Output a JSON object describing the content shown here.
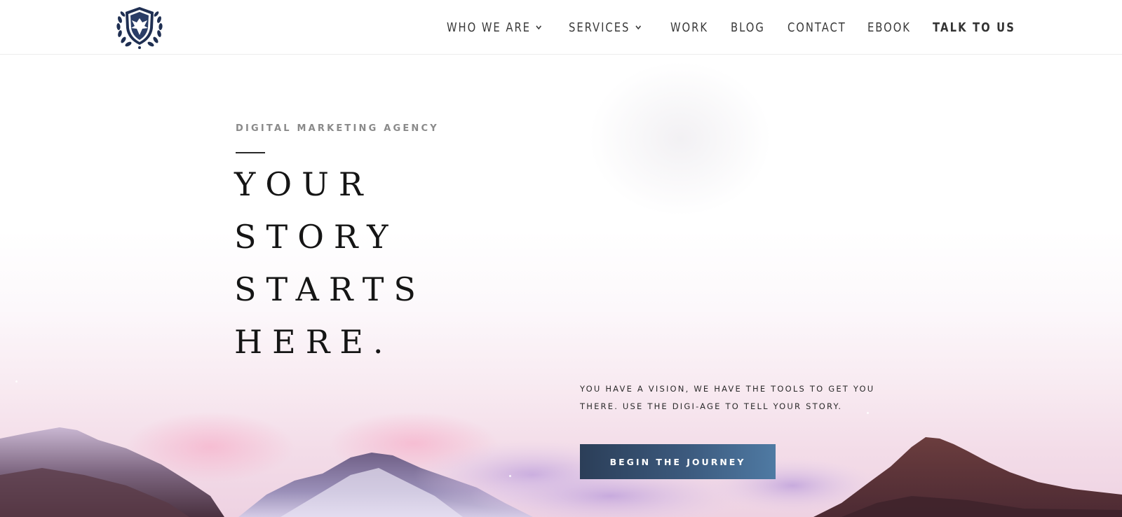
{
  "header": {
    "logo_icon": "eagle-shield-laurel-logo",
    "nav": [
      {
        "label": "WHO WE ARE",
        "has_dropdown": true
      },
      {
        "label": "SERVICES",
        "has_dropdown": true
      },
      {
        "label": "WORK",
        "has_dropdown": false
      },
      {
        "label": "BLOG",
        "has_dropdown": false
      },
      {
        "label": "CONTACT",
        "has_dropdown": false
      },
      {
        "label": "EBOOK",
        "has_dropdown": false
      },
      {
        "label": "TALK TO US",
        "has_dropdown": false,
        "emphasized": true
      }
    ]
  },
  "hero": {
    "eyebrow": "DIGITAL MARKETING AGENCY",
    "headline_lines": [
      "YOUR",
      "STORY",
      "STARTS",
      "HERE."
    ],
    "tagline_lines": [
      "YOU HAVE A VISION, WE HAVE THE TOOLS TO GET YOU",
      "THERE. USE THE DIGI-AGE TO TELL YOUR STORY."
    ],
    "cta_label": "BEGIN THE JOURNEY",
    "background": "pink-sky-mountain-landscape"
  },
  "colors": {
    "cta_start": "#2b3e58",
    "cta_end": "#4f7aa3",
    "logo_navy": "#1f2f52",
    "sky_pink": "#f3dce8",
    "text_dark": "#151515"
  }
}
